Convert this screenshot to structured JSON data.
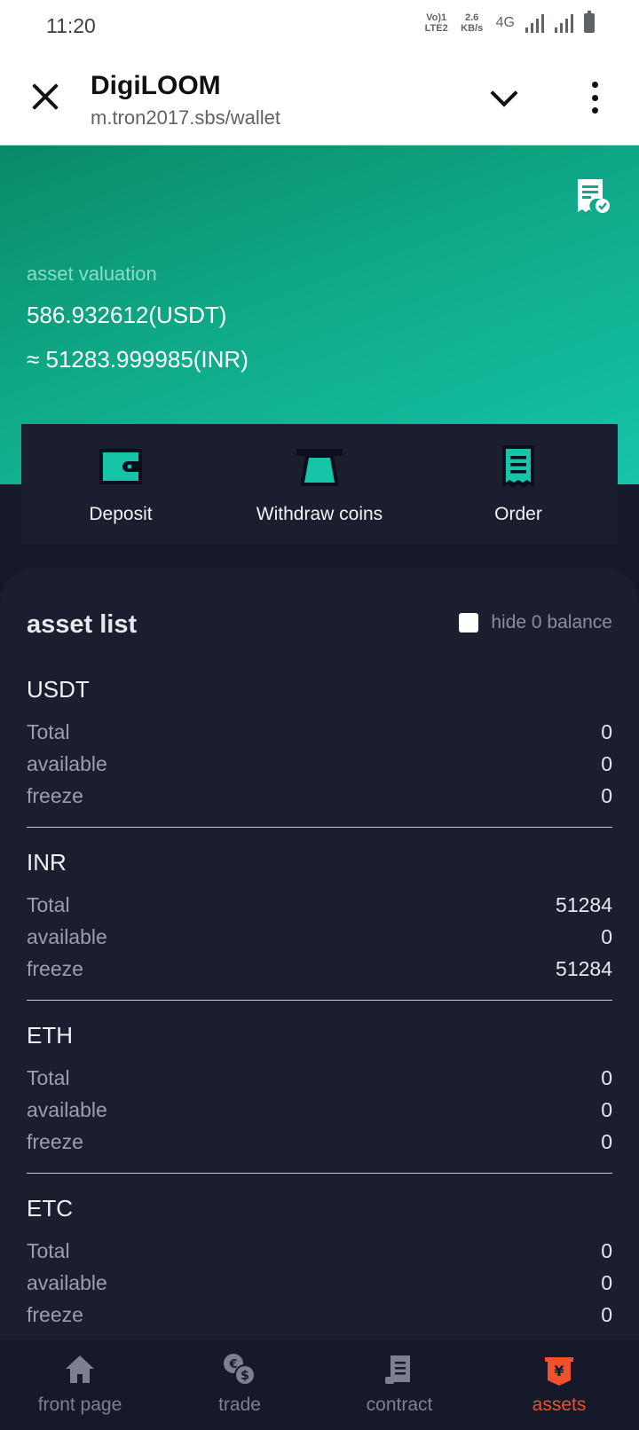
{
  "status_bar": {
    "time": "11:20",
    "volte": "Vo)1 LTE2",
    "speed": "2.6 KB/s",
    "network": "4G"
  },
  "browser": {
    "title": "DigiLOOM",
    "url": "m.tron2017.sbs/wallet"
  },
  "hero": {
    "label": "asset valuation",
    "usdt_value": "586.932612(USDT)",
    "inr_value": "≈ 51283.999985(INR)",
    "icon": "receipt-check-icon"
  },
  "actions": [
    {
      "label": "Deposit",
      "icon": "wallet-icon"
    },
    {
      "label": "Withdraw coins",
      "icon": "atm-icon"
    },
    {
      "label": "Order",
      "icon": "receipt-icon"
    }
  ],
  "asset_list": {
    "title": "asset list",
    "hide_zero_label": "hide 0 balance",
    "assets": [
      {
        "name": "USDT",
        "rows": [
          {
            "label": "Total",
            "value": "0"
          },
          {
            "label": "available",
            "value": "0"
          },
          {
            "label": "freeze",
            "value": "0"
          }
        ]
      },
      {
        "name": "INR",
        "rows": [
          {
            "label": "Total",
            "value": "51284"
          },
          {
            "label": "available",
            "value": "0"
          },
          {
            "label": "freeze",
            "value": "51284"
          }
        ]
      },
      {
        "name": "ETH",
        "rows": [
          {
            "label": "Total",
            "value": "0"
          },
          {
            "label": "available",
            "value": "0"
          },
          {
            "label": "freeze",
            "value": "0"
          }
        ]
      },
      {
        "name": "ETC",
        "rows": [
          {
            "label": "Total",
            "value": "0"
          },
          {
            "label": "available",
            "value": "0"
          },
          {
            "label": "freeze",
            "value": "0"
          }
        ]
      }
    ]
  },
  "bottom_nav": [
    {
      "label": "front page",
      "icon": "home-icon"
    },
    {
      "label": "trade",
      "icon": "currency-exchange-icon"
    },
    {
      "label": "contract",
      "icon": "contract-icon"
    },
    {
      "label": "assets",
      "icon": "yen-wallet-icon",
      "active": true
    }
  ],
  "colors": {
    "accent": "#16c4a8",
    "active_nav": "#f0502d",
    "panel_bg": "#1a1e2f"
  }
}
